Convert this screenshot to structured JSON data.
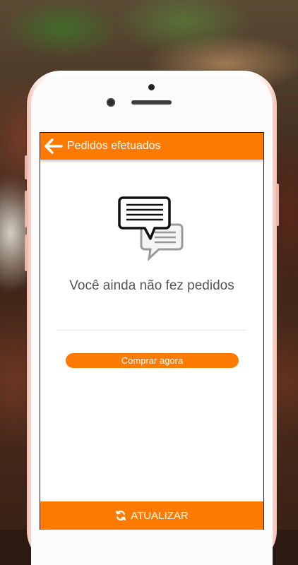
{
  "header": {
    "title": "Pedidos efetuados",
    "back_icon": "arrow-left-icon"
  },
  "empty_state": {
    "icon": "chat-bubbles-icon",
    "message": "Você ainda não fez pedidos"
  },
  "actions": {
    "buy_now_label": "Comprar agora",
    "refresh_label": "ATUALIZAR",
    "refresh_icon": "refresh-icon"
  },
  "colors": {
    "accent": "#ff7a00",
    "text_muted": "#555555",
    "phone_frame": "#f2c2b6"
  }
}
